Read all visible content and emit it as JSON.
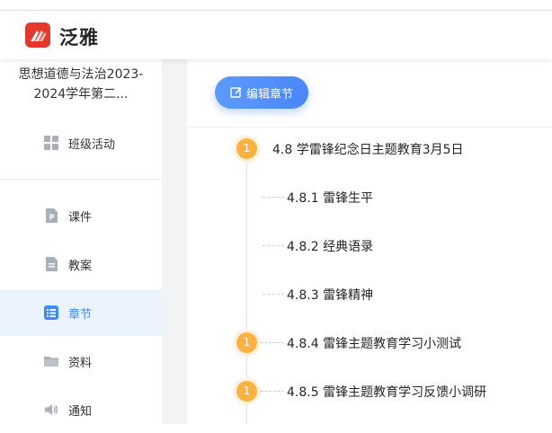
{
  "header": {
    "logo_text": "泛雅",
    "logo_icon": "chaoxing-wing-icon",
    "brand_color": "#e5372b"
  },
  "sidebar": {
    "course_title": "思想道德与法治2023-2024学年第二...",
    "items": [
      {
        "label": "班级活动",
        "icon": "grid-icon"
      },
      {
        "label": "课件",
        "icon": "ppt-file-icon"
      },
      {
        "label": "教案",
        "icon": "lesson-plan-icon"
      },
      {
        "label": "章节",
        "icon": "list-icon",
        "active": true
      },
      {
        "label": "资料",
        "icon": "folder-icon"
      },
      {
        "label": "通知",
        "icon": "speaker-icon"
      }
    ],
    "active_color": "#3a8bff"
  },
  "main": {
    "edit_button_label": "编辑章节",
    "chapters": [
      {
        "badge": "1",
        "title": "4.8 学雷锋纪念日主题教育3月5日"
      },
      {
        "badge": "",
        "title": "4.8.1 雷锋生平"
      },
      {
        "badge": "",
        "title": "4.8.2 经典语录"
      },
      {
        "badge": "",
        "title": "4.8.3 雷锋精神"
      },
      {
        "badge": "1",
        "title": "4.8.4 雷锋主题教育学习小测试"
      },
      {
        "badge": "1",
        "title": "4.8.5 雷锋主题教育学习反馈小调研"
      }
    ],
    "badge_color": "#ffb13d"
  }
}
